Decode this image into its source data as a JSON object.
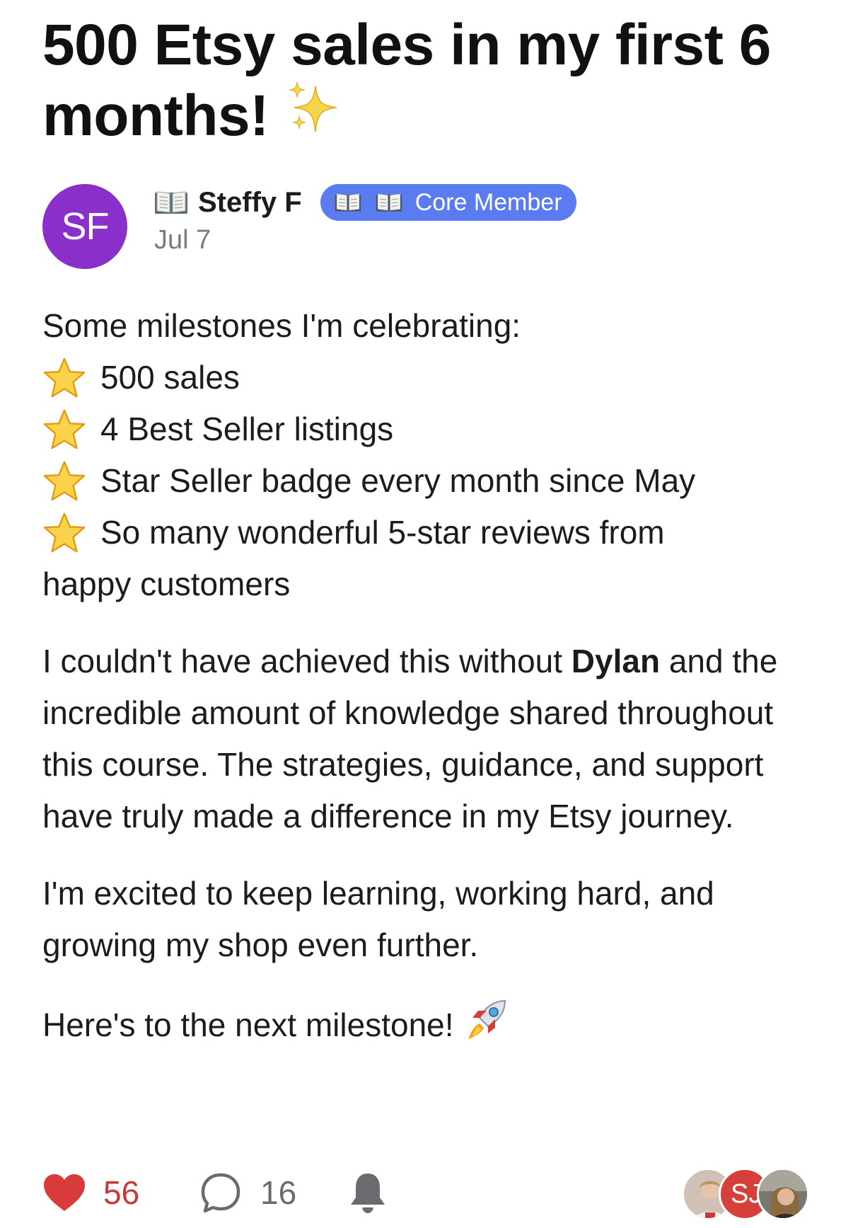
{
  "post": {
    "title": "500 Etsy sales in my first 6 months!",
    "title_emoji": "sparkles-icon",
    "author": {
      "initials": "SF",
      "name": "Steffy F",
      "avatar_color": "#8a2fc9",
      "badge_label": "Core Member",
      "badge_color": "#5b7cf0",
      "date": "Jul 7"
    },
    "intro": "Some milestones I'm celebrating:",
    "milestones": [
      "500 sales",
      "4 Best Seller listings",
      "Star Seller badge every month since May",
      "So many wonderful 5-star reviews from"
    ],
    "milestone_continuation": "happy customers",
    "paragraph1": {
      "before": "I couldn't have achieved this without ",
      "bold": "Dylan",
      "after": " and the incredible amount of knowledge shared throughout this course. The strategies, guidance, and support have truly made a difference in my Etsy journey."
    },
    "paragraph2": "I'm excited to keep learning, working hard, and growing my shop even further.",
    "paragraph3": "Here's to the next milestone!"
  },
  "footer": {
    "likes": "56",
    "comments": "16",
    "like_color": "#d93a3a",
    "participant_initials": "SJ"
  }
}
